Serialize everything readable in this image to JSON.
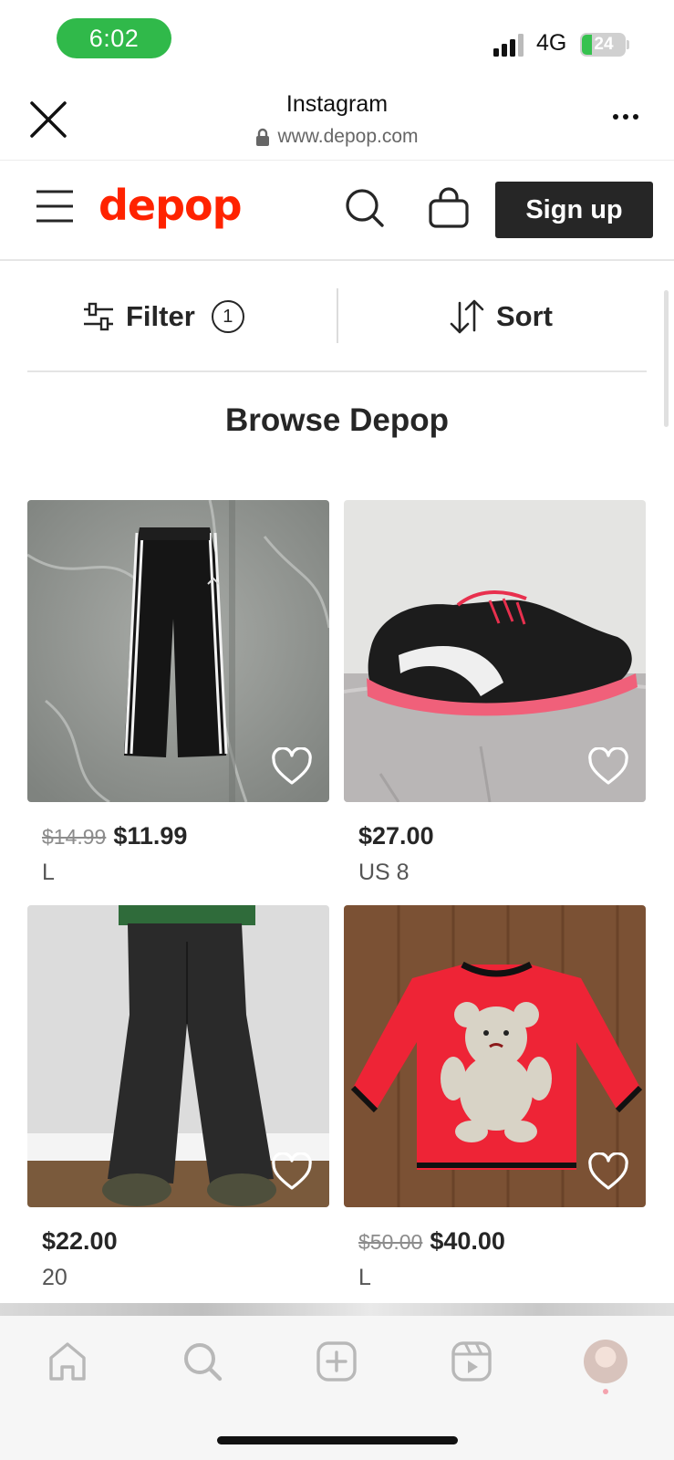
{
  "status_bar": {
    "time": "6:02",
    "network": "4G",
    "battery": "24"
  },
  "browser": {
    "title": "Instagram",
    "url": "www.depop.com"
  },
  "site_nav": {
    "logo": "depop",
    "signup_label": "Sign up"
  },
  "filter_bar": {
    "filter_label": "Filter",
    "filter_count": "1",
    "sort_label": "Sort"
  },
  "page": {
    "title": "Browse Depop"
  },
  "products": [
    {
      "old_price": "$14.99",
      "price": "$11.99",
      "size": "L",
      "image": "black-track-pants"
    },
    {
      "old_price": "",
      "price": "$27.00",
      "size": "US 8",
      "image": "black-pink-sneakers"
    },
    {
      "old_price": "",
      "price": "$22.00",
      "size": "20",
      "image": "black-flare-trousers"
    },
    {
      "old_price": "$50.00",
      "price": "$40.00",
      "size": "L",
      "image": "red-teddy-sweater"
    }
  ],
  "colors": {
    "brand": "#ff2300",
    "signup_bg": "#262626",
    "time_pill": "#30b94a"
  },
  "tab_bar": {
    "tabs": [
      "home-icon",
      "search-icon",
      "create-icon",
      "reels-icon",
      "profile-avatar"
    ]
  }
}
